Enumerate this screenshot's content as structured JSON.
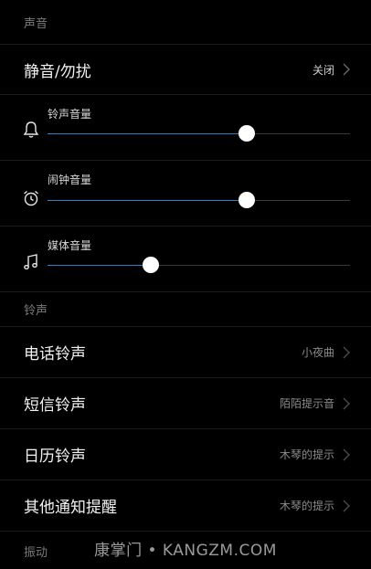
{
  "sections": {
    "sound_header": "声音",
    "ringtone_header": "铃声",
    "vibration_header": "振动"
  },
  "dnd": {
    "label": "静音/勿扰",
    "value": "关闭"
  },
  "volumes": [
    {
      "label": "铃声音量",
      "icon": "bell-icon",
      "level": 0.66
    },
    {
      "label": "闹钟音量",
      "icon": "alarm-clock-icon",
      "level": 0.66
    },
    {
      "label": "媒体音量",
      "icon": "music-note-icon",
      "level": 0.34
    }
  ],
  "ringtones": [
    {
      "label": "电话铃声",
      "value": "小夜曲"
    },
    {
      "label": "短信铃声",
      "value": "陌陌提示音"
    },
    {
      "label": "日历铃声",
      "value": "木琴的提示"
    },
    {
      "label": "其他通知提醒",
      "value": "木琴的提示"
    }
  ],
  "watermark": "康掌门 • KANGZM.COM",
  "colors": {
    "background": "#000000",
    "accent": "#2d7fc8",
    "divider": "#1a1a1a",
    "secondary_text": "#8a8a8a"
  }
}
